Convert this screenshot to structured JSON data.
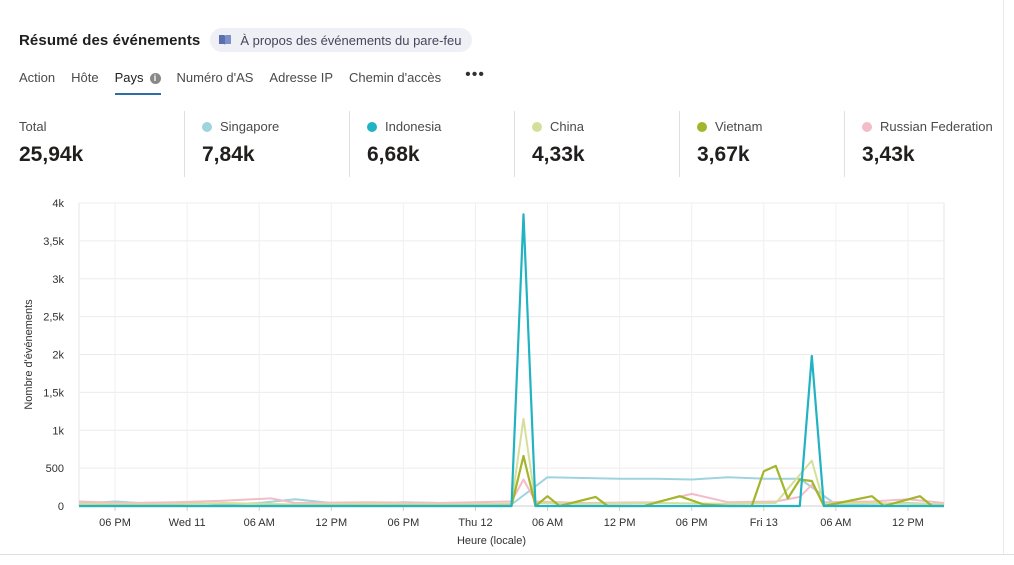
{
  "header": {
    "title": "Résumé des événements",
    "about_label": "À propos des événements du pare-feu"
  },
  "tabs": [
    "Action",
    "Hôte",
    "Pays",
    "Numéro d'AS",
    "Adresse IP",
    "Chemin d'accès"
  ],
  "active_tab": "Pays",
  "stats": [
    {
      "label": "Total",
      "value": "25,94k",
      "color": ""
    },
    {
      "label": "Singapore",
      "value": "7,84k",
      "color": "#9fd3de"
    },
    {
      "label": "Indonesia",
      "value": "6,68k",
      "color": "#22b3c2"
    },
    {
      "label": "China",
      "value": "4,33k",
      "color": "#d6df9a"
    },
    {
      "label": "Vietnam",
      "value": "3,67k",
      "color": "#a3b52a"
    },
    {
      "label": "Russian Federation",
      "value": "3,43k",
      "color": "#f2bcc8"
    }
  ],
  "chart_data": {
    "type": "line",
    "ylabel": "Nombre d'événements",
    "xlabel": "Heure (locale)",
    "yticks": [
      "0",
      "500",
      "1k",
      "1,5k",
      "2k",
      "2,5k",
      "3k",
      "3,5k",
      "4k"
    ],
    "ylim": [
      0,
      4000
    ],
    "xticks": [
      "06 PM",
      "Wed 11",
      "06 AM",
      "12 PM",
      "06 PM",
      "Thu 12",
      "06 AM",
      "12 PM",
      "06 PM",
      "Fri 13",
      "06 AM",
      "12 PM"
    ],
    "xlim": [
      0,
      72
    ],
    "x_unit": "hours",
    "grid": true,
    "series": [
      {
        "name": "Singapore",
        "color": "#9fd3de",
        "points": [
          [
            0,
            30
          ],
          [
            3,
            60
          ],
          [
            6,
            30
          ],
          [
            9,
            50
          ],
          [
            12,
            20
          ],
          [
            15,
            40
          ],
          [
            18,
            90
          ],
          [
            21,
            40
          ],
          [
            24,
            30
          ],
          [
            27,
            50
          ],
          [
            30,
            40
          ],
          [
            33,
            30
          ],
          [
            36,
            20
          ],
          [
            39,
            380
          ],
          [
            42,
            370
          ],
          [
            45,
            360
          ],
          [
            48,
            360
          ],
          [
            51,
            350
          ],
          [
            54,
            380
          ],
          [
            57,
            360
          ],
          [
            60,
            360
          ],
          [
            63,
            20
          ],
          [
            66,
            30
          ],
          [
            69,
            40
          ],
          [
            72,
            20
          ]
        ]
      },
      {
        "name": "Indonesia",
        "color": "#22b3c2",
        "points": [
          [
            0,
            0
          ],
          [
            20,
            0
          ],
          [
            30,
            0
          ],
          [
            36,
            0
          ],
          [
            37,
            3850
          ],
          [
            38,
            0
          ],
          [
            40,
            0
          ],
          [
            50,
            0
          ],
          [
            58,
            0
          ],
          [
            60,
            0
          ],
          [
            61,
            1980
          ],
          [
            62,
            0
          ],
          [
            66,
            0
          ],
          [
            72,
            0
          ]
        ]
      },
      {
        "name": "China",
        "color": "#d6df9a",
        "points": [
          [
            0,
            30
          ],
          [
            6,
            20
          ],
          [
            12,
            40
          ],
          [
            18,
            20
          ],
          [
            24,
            30
          ],
          [
            30,
            20
          ],
          [
            36,
            30
          ],
          [
            37,
            1150
          ],
          [
            38,
            40
          ],
          [
            42,
            30
          ],
          [
            48,
            40
          ],
          [
            54,
            30
          ],
          [
            58,
            40
          ],
          [
            61,
            600
          ],
          [
            62,
            30
          ],
          [
            66,
            40
          ],
          [
            72,
            20
          ]
        ]
      },
      {
        "name": "Vietnam",
        "color": "#a3b52a",
        "points": [
          [
            0,
            0
          ],
          [
            12,
            0
          ],
          [
            24,
            0
          ],
          [
            36,
            0
          ],
          [
            37,
            660
          ],
          [
            38,
            0
          ],
          [
            39,
            130
          ],
          [
            40,
            0
          ],
          [
            43,
            120
          ],
          [
            44,
            0
          ],
          [
            47,
            0
          ],
          [
            50,
            130
          ],
          [
            52,
            20
          ],
          [
            54,
            0
          ],
          [
            56,
            0
          ],
          [
            57,
            460
          ],
          [
            58,
            530
          ],
          [
            59,
            100
          ],
          [
            60,
            350
          ],
          [
            61,
            330
          ],
          [
            62,
            0
          ],
          [
            66,
            130
          ],
          [
            67,
            0
          ],
          [
            70,
            130
          ],
          [
            71,
            0
          ],
          [
            72,
            0
          ]
        ]
      },
      {
        "name": "Russian Federation",
        "color": "#f2bcc8",
        "points": [
          [
            0,
            60
          ],
          [
            4,
            40
          ],
          [
            8,
            50
          ],
          [
            12,
            70
          ],
          [
            16,
            100
          ],
          [
            18,
            40
          ],
          [
            24,
            50
          ],
          [
            30,
            40
          ],
          [
            36,
            60
          ],
          [
            37,
            350
          ],
          [
            38,
            60
          ],
          [
            42,
            40
          ],
          [
            48,
            50
          ],
          [
            51,
            160
          ],
          [
            54,
            50
          ],
          [
            58,
            60
          ],
          [
            60,
            120
          ],
          [
            61,
            280
          ],
          [
            62,
            50
          ],
          [
            66,
            60
          ],
          [
            69,
            90
          ],
          [
            72,
            40
          ]
        ]
      }
    ]
  }
}
